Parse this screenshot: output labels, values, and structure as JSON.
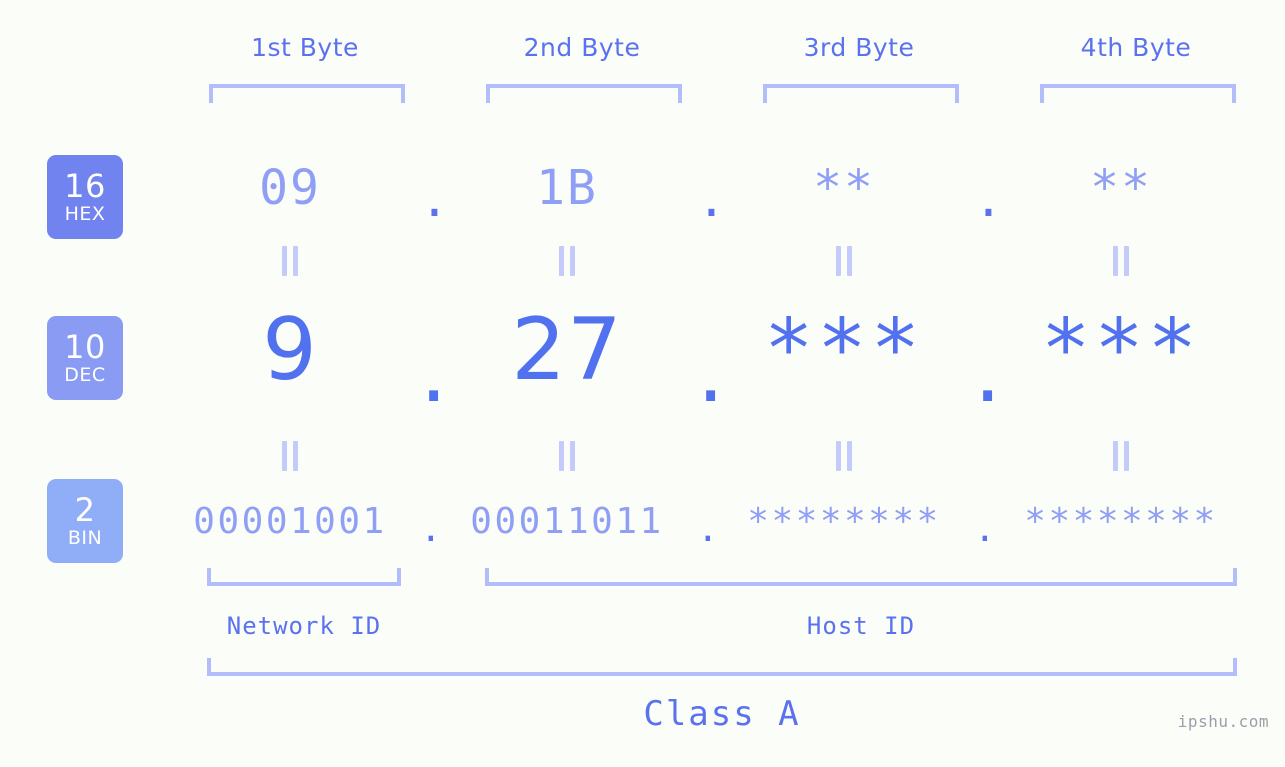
{
  "background_color": "#fbfdf8",
  "accent_color": "#5271ef",
  "muted_color": "#8f9ff5",
  "bracket_color": "#b3bdfb",
  "byte_headers": [
    {
      "label": "1st Byte"
    },
    {
      "label": "2nd Byte"
    },
    {
      "label": "3rd Byte"
    },
    {
      "label": "4th Byte"
    }
  ],
  "bases": [
    {
      "number": "16",
      "name": "HEX",
      "color": "#7083ef"
    },
    {
      "number": "10",
      "name": "DEC",
      "color": "#8a9bf4"
    },
    {
      "number": "2",
      "name": "BIN",
      "color": "#90aef7"
    }
  ],
  "separator": ".",
  "rows": {
    "hex": {
      "base": "16",
      "values": [
        "09",
        "1B",
        "**",
        "**"
      ]
    },
    "dec": {
      "base": "10",
      "values": [
        "9",
        "27",
        "***",
        "***"
      ]
    },
    "bin": {
      "base": "2",
      "values": [
        "00001001",
        "00011011",
        "********",
        "********"
      ]
    }
  },
  "id_sections": [
    {
      "label": "Network ID"
    },
    {
      "label": "Host ID"
    }
  ],
  "class_label": "Class A",
  "watermark": "ipshu.com"
}
